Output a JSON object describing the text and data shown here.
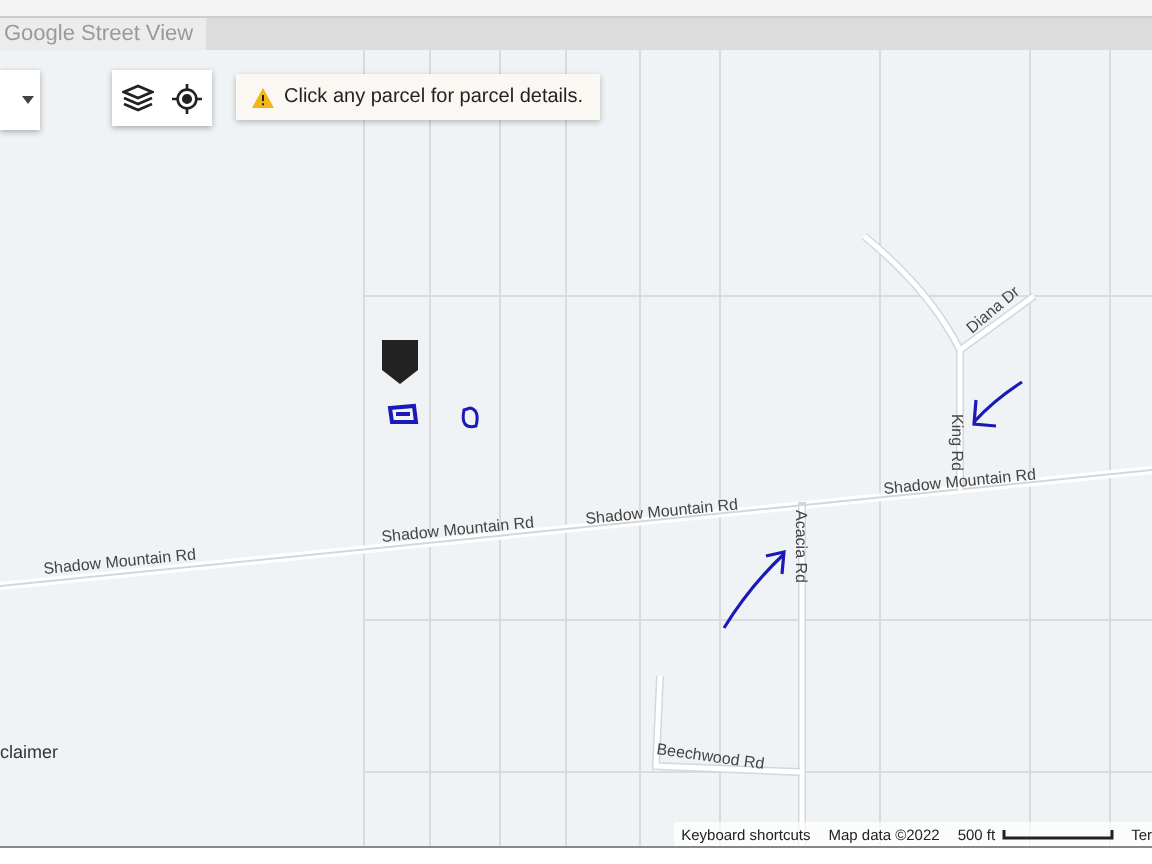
{
  "tab": {
    "label": "Google Street View"
  },
  "toolbar": {
    "alert": "Click any parcel for parcel details."
  },
  "map": {
    "road_labels": [
      {
        "name": "Shadow Mountain Rd"
      },
      {
        "name": "Shadow Mountain Rd"
      },
      {
        "name": "Shadow Mountain Rd"
      },
      {
        "name": "Shadow Mountain Rd"
      },
      {
        "name": "Acacia Rd"
      },
      {
        "name": "King Rd"
      },
      {
        "name": "Diana Dr"
      },
      {
        "name": "Beechwood Rd"
      }
    ]
  },
  "disclaimer": "claimer",
  "footer": [
    "Keyboard shortcuts",
    "Map data ©2022",
    "500 ft",
    "Ter"
  ]
}
